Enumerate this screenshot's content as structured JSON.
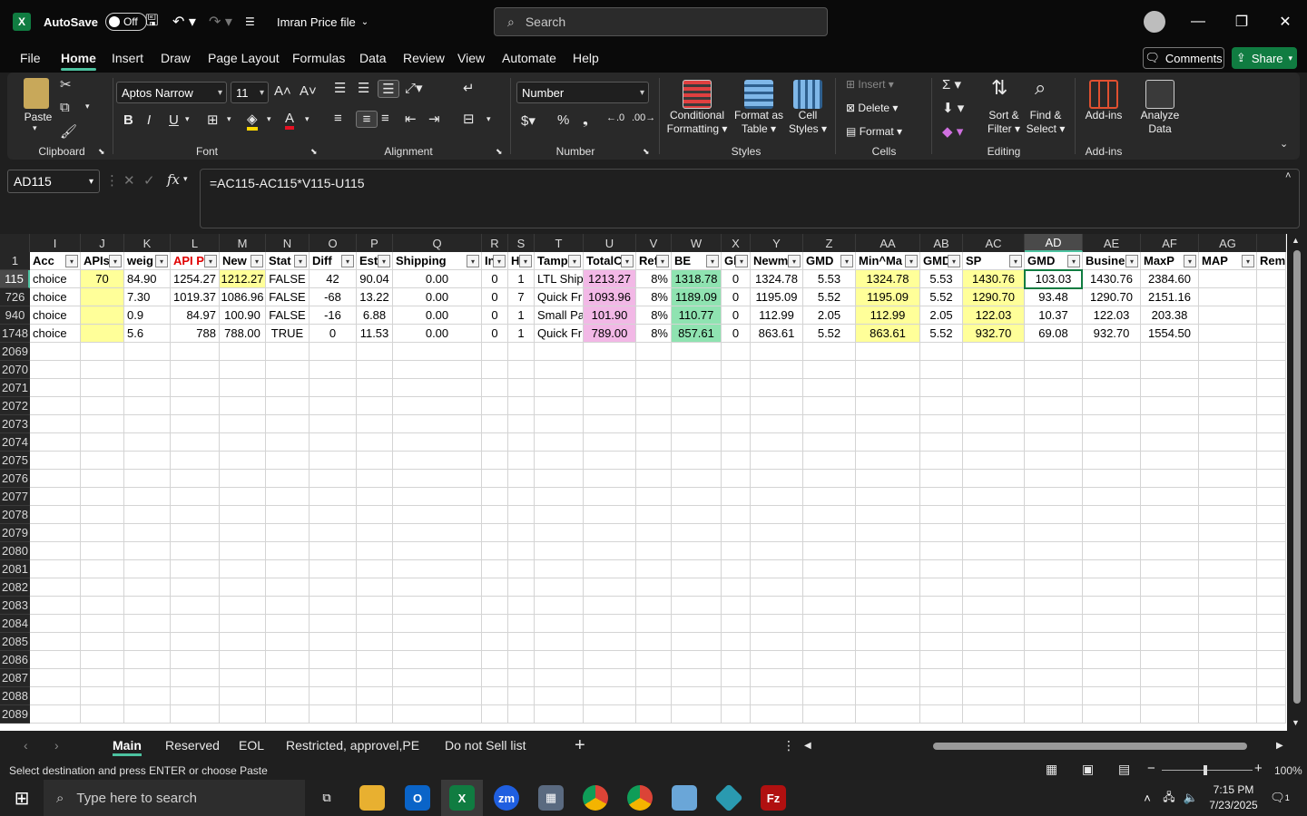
{
  "titlebar": {
    "autosave_label": "AutoSave",
    "autosave_state": "Off",
    "file_name": "Imran Price file",
    "search_placeholder": "Search"
  },
  "menubar": {
    "items": [
      "File",
      "Home",
      "Insert",
      "Draw",
      "Page Layout",
      "Formulas",
      "Data",
      "Review",
      "View",
      "Automate",
      "Help"
    ],
    "active": "Home",
    "comments_label": "Comments",
    "share_label": "Share"
  },
  "ribbon": {
    "clipboard": {
      "paste": "Paste",
      "label": "Clipboard"
    },
    "font": {
      "name": "Aptos Narrow",
      "size": "11",
      "label": "Font"
    },
    "alignment": {
      "label": "Alignment"
    },
    "number": {
      "format": "Number",
      "label": "Number"
    },
    "styles": {
      "conditional": "Conditional",
      "conditional2": "Formatting",
      "format_table": "Format as",
      "format_table2": "Table",
      "cell_styles": "Cell",
      "cell_styles2": "Styles",
      "label": "Styles"
    },
    "cells": {
      "insert": "Insert",
      "delete": "Delete",
      "format": "Format",
      "label": "Cells"
    },
    "editing": {
      "sort": "Sort &",
      "sort2": "Filter",
      "find": "Find &",
      "find2": "Select",
      "label": "Editing"
    },
    "addins": {
      "addins": "Add-ins",
      "analyze": "Analyze",
      "analyze2": "Data",
      "label": "Add-ins"
    }
  },
  "formula_bar": {
    "name_box": "AD115",
    "formula": "=AC115-AC115*V115-U115"
  },
  "grid": {
    "columns": [
      "I",
      "J",
      "K",
      "L",
      "M",
      "N",
      "O",
      "P",
      "Q",
      "R",
      "S",
      "T",
      "U",
      "V",
      "W",
      "X",
      "Y",
      "Z",
      "AA",
      "AB",
      "AC",
      "AD",
      "AE",
      "AF",
      "AG",
      ""
    ],
    "header_row_number": "1",
    "headers": [
      "Acc",
      "APIs",
      "weig",
      "API P",
      "New",
      "Stat",
      "Diff",
      "Ests",
      "Shipping",
      "In",
      "H",
      "Tamp",
      "TotalC",
      "Ref",
      "BE",
      "Gl",
      "Newm",
      "GMD",
      "Min^Ma",
      "GMD",
      "SP",
      "GMD",
      "Busine",
      "MaxP",
      "MAP",
      "Rem"
    ],
    "rows": [
      {
        "num": "115",
        "cells": [
          "choice",
          "70",
          "84.90",
          "1254.27",
          "1212.27",
          "FALSE",
          "42",
          "90.04",
          "0.00",
          "0",
          "1",
          "LTL Shipp",
          "1213.27",
          "8%",
          "1318.78",
          "0",
          "1324.78",
          "5.53",
          "1324.78",
          "5.53",
          "1430.76",
          "103.03",
          "1430.76",
          "2384.60",
          "",
          ""
        ]
      },
      {
        "num": "726",
        "cells": [
          "choice",
          "",
          "7.30",
          "1019.37",
          "1086.96",
          "FALSE",
          "-68",
          "13.22",
          "0.00",
          "0",
          "7",
          "Quick Fr",
          "1093.96",
          "8%",
          "1189.09",
          "0",
          "1195.09",
          "5.52",
          "1195.09",
          "5.52",
          "1290.70",
          "93.48",
          "1290.70",
          "2151.16",
          "",
          ""
        ]
      },
      {
        "num": "940",
        "cells": [
          "choice",
          "",
          "0.9",
          "84.97",
          "100.90",
          "FALSE",
          "-16",
          "6.88",
          "0.00",
          "0",
          "1",
          "Small Pa",
          "101.90",
          "8%",
          "110.77",
          "0",
          "112.99",
          "2.05",
          "112.99",
          "2.05",
          "122.03",
          "10.37",
          "122.03",
          "203.38",
          "",
          ""
        ]
      },
      {
        "num": "1748",
        "cells": [
          "choice",
          "",
          "5.6",
          "788",
          "788.00",
          "TRUE",
          "0",
          "11.53",
          "0.00",
          "0",
          "1",
          "Quick Fr",
          "789.00",
          "8%",
          "857.61",
          "0",
          "863.61",
          "5.52",
          "863.61",
          "5.52",
          "932.70",
          "69.08",
          "932.70",
          "1554.50",
          "",
          ""
        ]
      }
    ],
    "empty_rows": [
      "2069",
      "2070",
      "2071",
      "2072",
      "2073",
      "2074",
      "2075",
      "2076",
      "2077",
      "2078",
      "2079",
      "2080",
      "2081",
      "2082",
      "2083",
      "2084",
      "2085",
      "2086",
      "2087",
      "2088",
      "2089"
    ],
    "selected_column": "AD",
    "selected_row": "115"
  },
  "sheets": {
    "tabs": [
      "Main",
      "Reserved",
      "EOL",
      "Restricted, approvel,PE",
      "Do not Sell list"
    ],
    "active": "Main"
  },
  "status": {
    "message": "Select destination and press ENTER or choose Paste",
    "zoom": "100%"
  },
  "taskbar": {
    "search_placeholder": "Type here to search",
    "time": "7:15 PM",
    "date": "7/23/2025",
    "notification_count": "1"
  }
}
